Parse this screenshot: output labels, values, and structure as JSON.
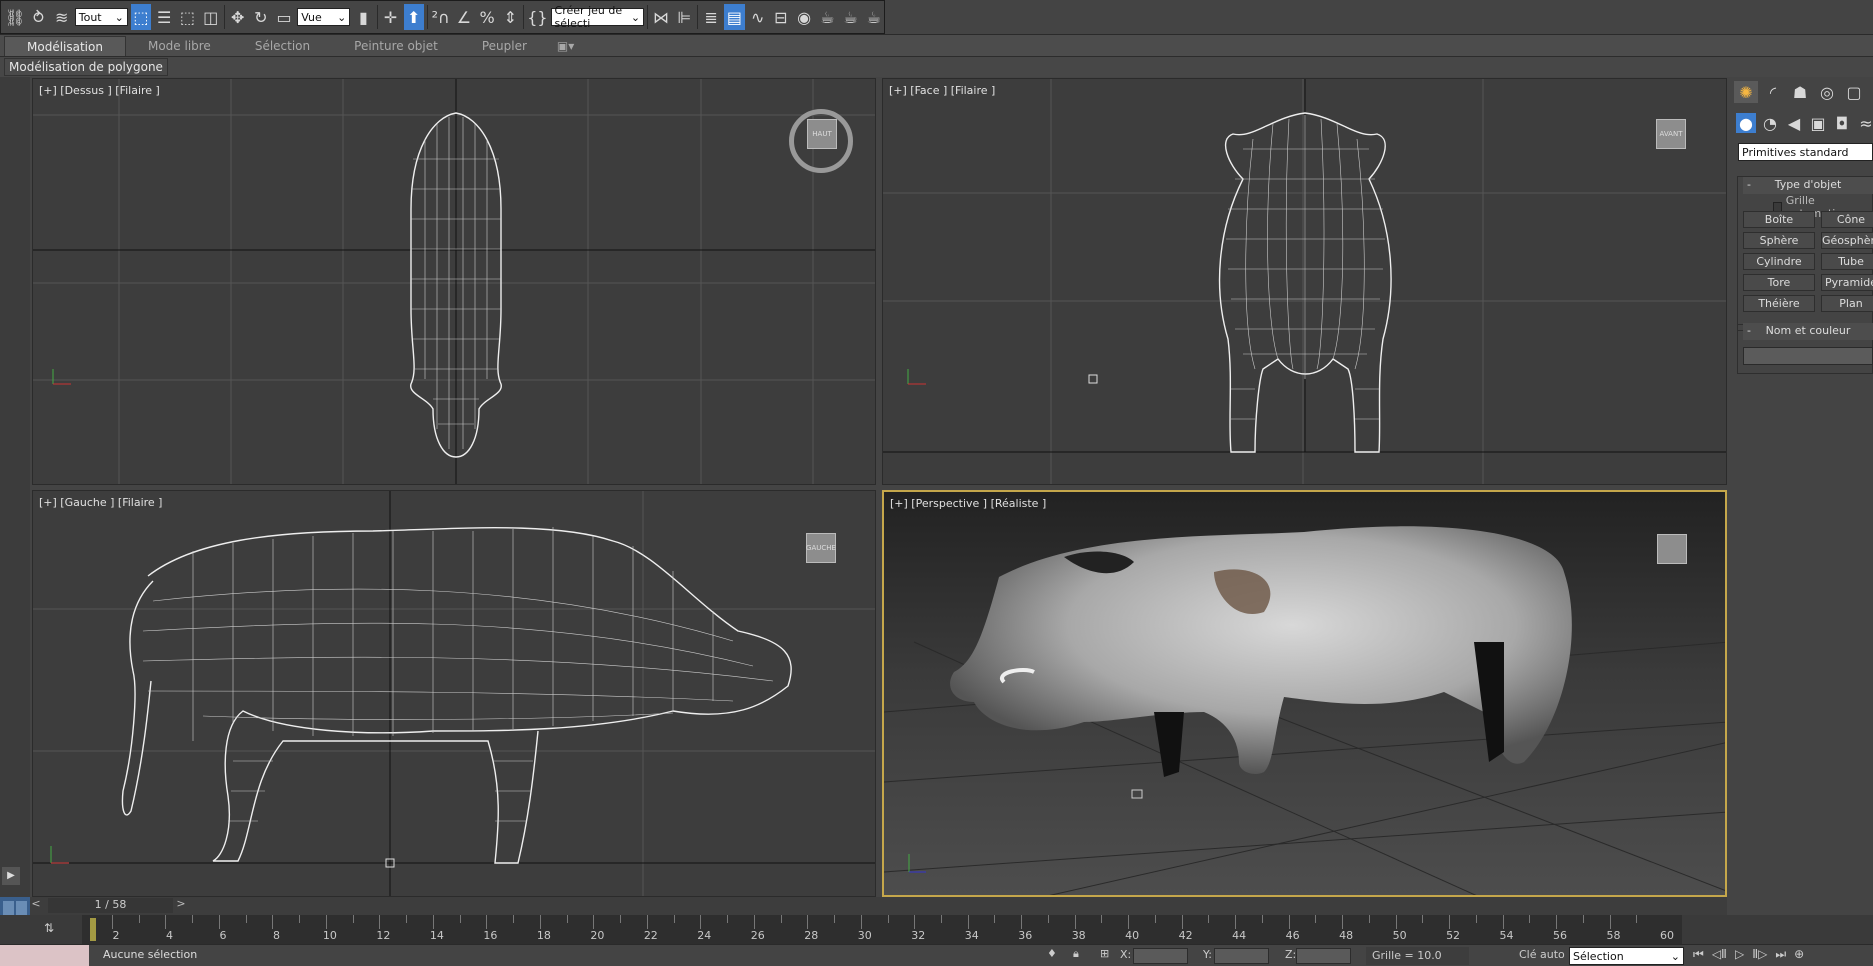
{
  "toolbar": {
    "filter": "Tout",
    "coord": "Vue",
    "selset": "Créer jeu de sélecti",
    "icons": [
      "link-icon",
      "unlink-icon",
      "bind-spacewarp-icon",
      "select-object-icon",
      "select-by-name-icon",
      "rect-selection-icon",
      "window-crossing-icon",
      "move-icon",
      "rotate-icon",
      "scale-icon",
      "pivot-icon",
      "select-manipulate-icon",
      "snap-2d-icon",
      "angle-snap-icon",
      "percent-snap-icon",
      "spinner-snap-icon",
      "edit-named-sets-icon",
      "mirror-icon",
      "align-icon",
      "layer-manager-icon",
      "scene-explorer-icon",
      "curve-editor-icon",
      "schematic-view-icon",
      "material-editor-icon",
      "render-setup-icon",
      "rendered-frame-icon",
      "render-icon"
    ]
  },
  "tabs": [
    "Modélisation",
    "Mode libre",
    "Sélection",
    "Peinture objet",
    "Peupler"
  ],
  "ribbon": {
    "label": "Modélisation de polygone"
  },
  "viewports": [
    {
      "label": "[+] [Dessus ] [Filaire ]",
      "cube": "HAUT"
    },
    {
      "label": "[+] [Face ] [Filaire ]",
      "cube": "AVANT"
    },
    {
      "label": "[+] [Gauche ] [Filaire ]",
      "cube": "GAUCHE"
    },
    {
      "label": "[+] [Perspective ] [Réaliste ]",
      "cube": ""
    }
  ],
  "command_panel": {
    "category": "Primitives standard",
    "rollout1": "Type d'objet",
    "autogrid": "Grille automatique",
    "buttons": [
      "Boîte",
      "Cône",
      "Sphère",
      "Géosphère",
      "Cylindre",
      "Tube",
      "Tore",
      "Pyramide",
      "Théière",
      "Plan"
    ],
    "rollout2": "Nom et couleur"
  },
  "timeline": {
    "frame": "1 / 58",
    "ticks": [
      2,
      4,
      6,
      8,
      10,
      12,
      14,
      16,
      18,
      20,
      22,
      24,
      26,
      28,
      30,
      32,
      34,
      36,
      38,
      40,
      42,
      44,
      46,
      48,
      50,
      52,
      54,
      56,
      58,
      60
    ],
    "current": 1,
    "total": 58
  },
  "status": {
    "text": "Aucune sélection",
    "x_label": "X:",
    "y_label": "Y:",
    "z_label": "Z:",
    "grid": "Grille = 10.0",
    "autokey": "Clé auto",
    "key_mode": "Sélection"
  }
}
